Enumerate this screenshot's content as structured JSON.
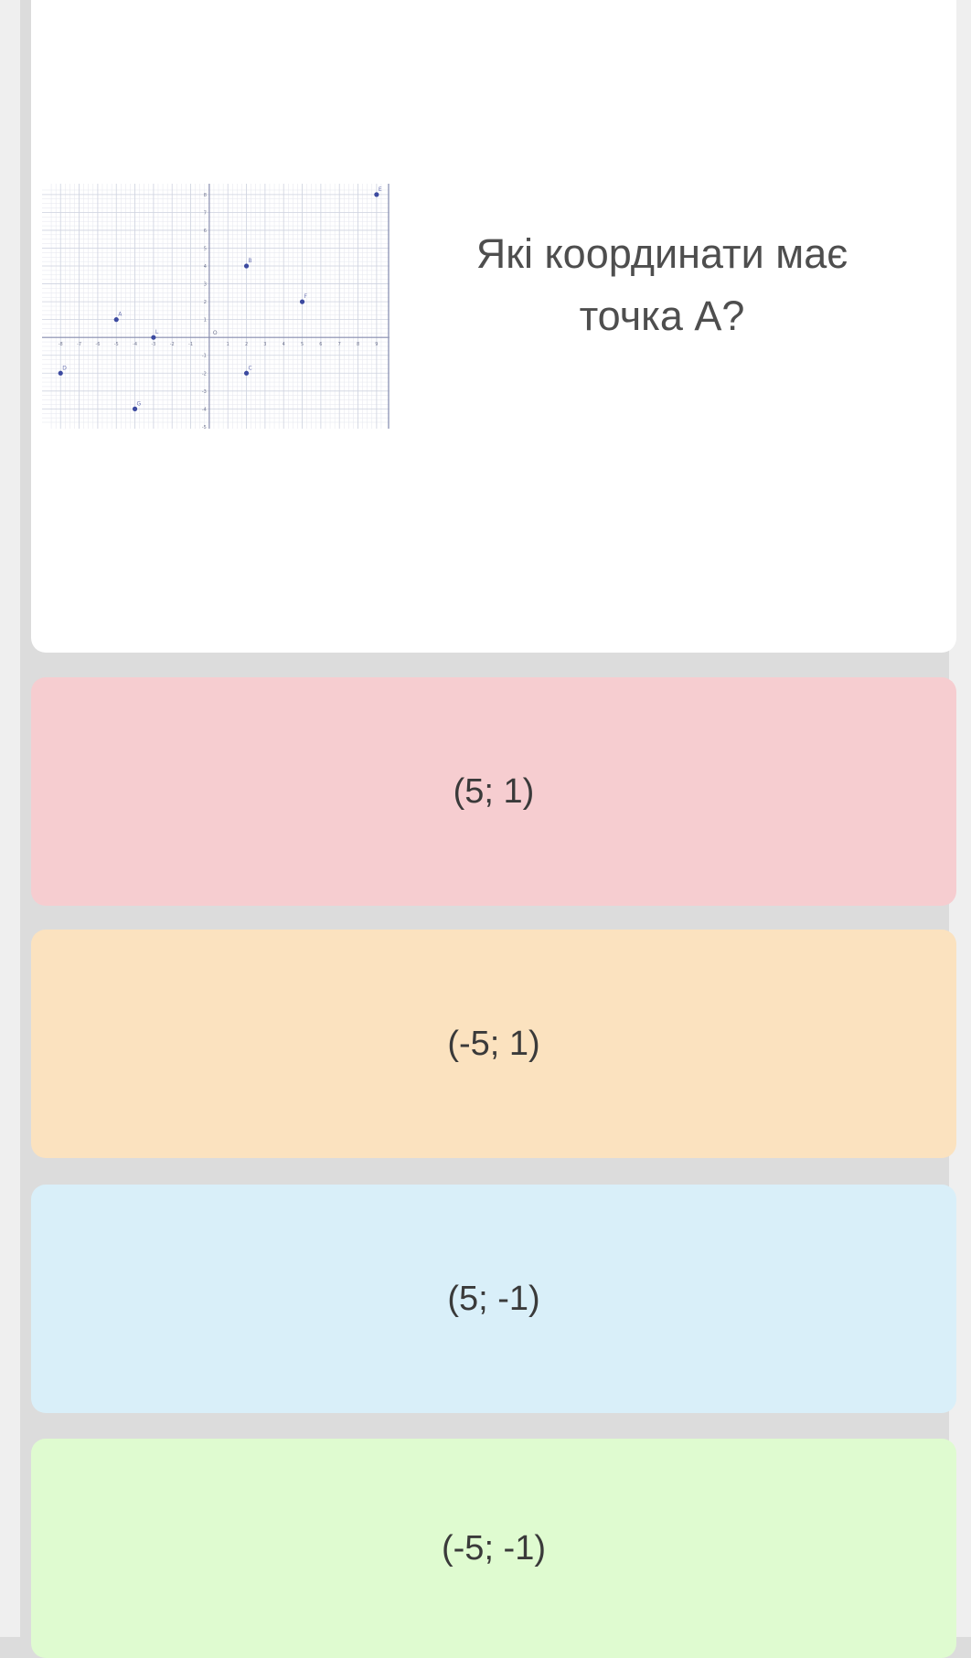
{
  "question": {
    "line1": "Які координати має",
    "line2": "точка А?"
  },
  "graph": {
    "points": [
      {
        "label": "A",
        "x": -5,
        "y": 1
      },
      {
        "label": "B",
        "x": 2,
        "y": 4
      },
      {
        "label": "C",
        "x": 2,
        "y": -2
      },
      {
        "label": "D",
        "x": -8,
        "y": -2
      },
      {
        "label": "E",
        "x": 9,
        "y": 8
      },
      {
        "label": "F",
        "x": 5,
        "y": 2
      },
      {
        "label": "G",
        "x": -4,
        "y": -4
      },
      {
        "label": "L",
        "x": -3,
        "y": 0
      }
    ],
    "origin_label": "O",
    "x_range": [
      -8,
      9
    ],
    "y_range": [
      -5,
      8
    ],
    "point_color": "#3c4aa0",
    "axis_color": "#8a8fb0",
    "grid_color": "#e4e6ee"
  },
  "answers": [
    {
      "label": "(5; 1)",
      "color": "#f6cdd0"
    },
    {
      "label": "(-5; 1)",
      "color": "#fbe2bf"
    },
    {
      "label": "(5; -1)",
      "color": "#d9eff9"
    },
    {
      "label": "(-5; -1)",
      "color": "#dffbd0"
    }
  ]
}
